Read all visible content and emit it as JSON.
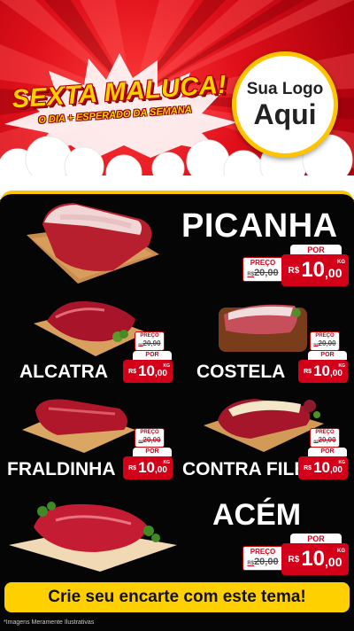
{
  "banner": {
    "title": "SEXTA MALUCA!",
    "subtitle": "O DIA + ESPERADO DA SEMANA",
    "logo_line1": "Sua Logo",
    "logo_line2": "Aqui"
  },
  "currency": "R$",
  "preco_label": "PREÇO",
  "por_label": "POR",
  "unit": "KG",
  "products": [
    {
      "name": "PICANHA",
      "old_price": "20,00",
      "price_int": "10",
      "price_dec": ",00"
    },
    {
      "name": "ALCATRA",
      "old_price": "20,00",
      "price_int": "10",
      "price_dec": ",00"
    },
    {
      "name": "COSTELA",
      "old_price": "20,00",
      "price_int": "10",
      "price_dec": ",00"
    },
    {
      "name": "FRALDINHA",
      "old_price": "20,00",
      "price_int": "10",
      "price_dec": ",00"
    },
    {
      "name": "CONTRA FILÉ",
      "old_price": "20,00",
      "price_int": "10",
      "price_dec": ",00"
    },
    {
      "name": "ACÉM",
      "old_price": "20,00",
      "price_int": "10",
      "price_dec": ",00"
    }
  ],
  "cta": "Crie seu encarte com este tema!",
  "disclaimer": "*Imagens Meramente Ilustrativas",
  "colors": {
    "red": "#d3001a",
    "yellow": "#ffd000",
    "gold_border": "#ffc400",
    "background": "#050505"
  }
}
